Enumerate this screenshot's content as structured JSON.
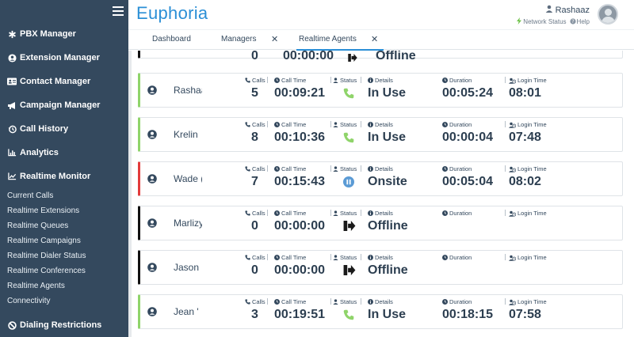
{
  "app": {
    "logo_text": "Euphoria",
    "user_name": "Rashaaz",
    "network_status_label": "Network Status",
    "help_label": "Help"
  },
  "sidebar": {
    "menu": [
      {
        "label": "PBX Manager",
        "icon": "asterisk-icon"
      },
      {
        "label": "Extension Manager",
        "icon": "user-circle-icon"
      },
      {
        "label": "Contact Manager",
        "icon": "address-card-icon"
      },
      {
        "label": "Campaign Manager",
        "icon": "megaphone-icon"
      },
      {
        "label": "Call History",
        "icon": "history-icon"
      },
      {
        "label": "Analytics",
        "icon": "bar-chart-icon"
      },
      {
        "label": "Realtime Monitor",
        "icon": "line-chart-icon"
      }
    ],
    "submenu": [
      "Current Calls",
      "Realtime Extensions",
      "Realtime Queues",
      "Realtime Campaigns",
      "Realtime Dialer Status",
      "Realtime Conferences",
      "Realtime Agents",
      "Connectivity"
    ],
    "bottom_item": {
      "label": "Dialing Restrictions",
      "icon": "ban-icon"
    }
  },
  "tabs": [
    {
      "label": "Dashboard",
      "closable": false
    },
    {
      "label": "Managers",
      "closable": true
    },
    {
      "label": "Realtime Agents",
      "closable": true,
      "active": true
    }
  ],
  "labels": {
    "calls": "Calls",
    "call_time": "Call Time",
    "status": "Status",
    "details": "Details",
    "duration": "Duration",
    "login_time": "Login Time"
  },
  "partial_row": {
    "calls": "0",
    "call_time": "00:00:00",
    "details": "Offline"
  },
  "agents": [
    {
      "name": "Rashaaz",
      "calls": "5",
      "call_time": "00:09:21",
      "status": "in-use",
      "details": "In Use",
      "duration": "00:05:24",
      "login_time": "08:01",
      "accent": "#8fd46a"
    },
    {
      "name": "Krelin",
      "calls": "8",
      "call_time": "00:10:36",
      "status": "in-use",
      "details": "In Use",
      "duration": "00:00:04",
      "login_time": "07:48",
      "accent": "#8fd46a"
    },
    {
      "name": "Wade (",
      "calls": "7",
      "call_time": "00:15:43",
      "status": "onsite",
      "details": "Onsite",
      "duration": "00:05:04",
      "login_time": "08:02",
      "accent": "#e23b3b"
    },
    {
      "name": "Marlizy",
      "calls": "0",
      "call_time": "00:00:00",
      "status": "offline",
      "details": "Offline",
      "duration": "",
      "login_time": "",
      "accent": "#111111"
    },
    {
      "name": "Jason",
      "calls": "0",
      "call_time": "00:00:00",
      "status": "offline",
      "details": "Offline",
      "duration": "",
      "login_time": "",
      "accent": "#111111"
    },
    {
      "name": "Jean '",
      "calls": "3",
      "call_time": "00:19:51",
      "status": "in-use",
      "details": "In Use",
      "duration": "00:18:15",
      "login_time": "07:58",
      "accent": "#8fd46a"
    }
  ],
  "colors": {
    "sidebar_bg": "#34495e",
    "brand": "#2b8fd6",
    "in_use": "#8fd46a",
    "onsite": "#5b9bd5",
    "busy": "#e23b3b"
  }
}
